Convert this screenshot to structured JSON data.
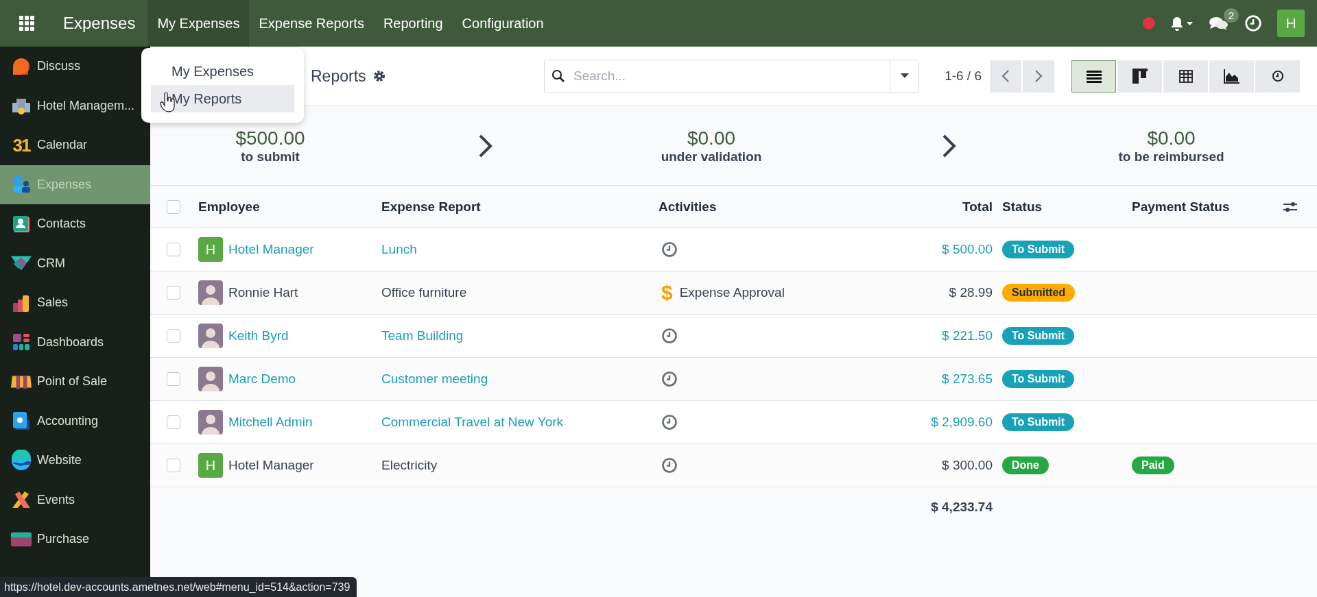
{
  "app_bar": {
    "title": "Expenses",
    "menus": [
      {
        "label": "My Expenses",
        "selected": true
      },
      {
        "label": "Expense Reports",
        "selected": false
      },
      {
        "label": "Reporting",
        "selected": false
      },
      {
        "label": "Configuration",
        "selected": false
      }
    ],
    "messages_badge": "2",
    "user_initial": "H"
  },
  "sidebar": {
    "items": [
      {
        "label": "Discuss",
        "selected": false
      },
      {
        "label": "Hotel Managem...",
        "selected": false
      },
      {
        "label": "Calendar",
        "icon_text": "31",
        "selected": false
      },
      {
        "label": "Expenses",
        "selected": true
      },
      {
        "label": "Contacts",
        "selected": false
      },
      {
        "label": "CRM",
        "selected": false
      },
      {
        "label": "Sales",
        "selected": false
      },
      {
        "label": "Dashboards",
        "selected": false
      },
      {
        "label": "Point of Sale",
        "selected": false
      },
      {
        "label": "Accounting",
        "selected": false
      },
      {
        "label": "Website",
        "selected": false
      },
      {
        "label": "Events",
        "selected": false
      },
      {
        "label": "Purchase",
        "selected": false
      }
    ]
  },
  "dropdown": {
    "items": [
      {
        "label": "My Expenses",
        "selected": false
      },
      {
        "label": "My Reports",
        "selected": true
      }
    ]
  },
  "control_panel": {
    "breadcrumb": "Reports",
    "search": {
      "placeholder": "Search..."
    },
    "pager": "1-6 / 6",
    "views": [
      {
        "kind": "list",
        "selected": true
      },
      {
        "kind": "kanban",
        "selected": false
      },
      {
        "kind": "pivot",
        "selected": false
      },
      {
        "kind": "graph",
        "selected": false
      },
      {
        "kind": "activity",
        "selected": false
      }
    ]
  },
  "summary": [
    {
      "amount": "$500.00",
      "label": "to submit"
    },
    {
      "amount": "$0.00",
      "label": "under validation"
    },
    {
      "amount": "$0.00",
      "label": "to be reimbursed"
    }
  ],
  "table": {
    "all_checked": false,
    "columns": [
      "Employee",
      "Expense Report",
      "Activities",
      "Total",
      "Status",
      "Payment Status"
    ],
    "rows": [
      {
        "checked": false,
        "linked": true,
        "avatar": {
          "kind": "letter",
          "text": "H"
        },
        "employee": "Hotel Manager",
        "report": "Lunch",
        "activity": {
          "kind": "clock"
        },
        "total": "$ 500.00",
        "status": {
          "label": "To Submit",
          "color": "#17a2b8"
        }
      },
      {
        "checked": false,
        "linked": false,
        "avatar": {
          "kind": "photo"
        },
        "employee": "Ronnie Hart",
        "report": "Office furniture",
        "activity": {
          "kind": "todo",
          "icon": "$",
          "label": "Expense Approval"
        },
        "total": "$ 28.99",
        "status": {
          "label": "Submitted",
          "color": "#ffac00"
        }
      },
      {
        "checked": false,
        "linked": true,
        "avatar": {
          "kind": "photo"
        },
        "employee": "Keith Byrd",
        "report": "Team Building",
        "activity": {
          "kind": "clock"
        },
        "total": "$ 221.50",
        "status": {
          "label": "To Submit",
          "color": "#17a2b8"
        }
      },
      {
        "checked": false,
        "linked": true,
        "avatar": {
          "kind": "photo"
        },
        "employee": "Marc Demo",
        "report": "Customer meeting",
        "activity": {
          "kind": "clock"
        },
        "total": "$ 273.65",
        "status": {
          "label": "To Submit",
          "color": "#17a2b8"
        }
      },
      {
        "checked": false,
        "linked": true,
        "avatar": {
          "kind": "photo"
        },
        "employee": "Mitchell Admin",
        "report": "Commercial Travel at New York",
        "activity": {
          "kind": "clock"
        },
        "total": "$ 2,909.60",
        "status": {
          "label": "To Submit",
          "color": "#17a2b8"
        }
      },
      {
        "checked": false,
        "linked": false,
        "avatar": {
          "kind": "letter",
          "text": "H"
        },
        "employee": "Hotel Manager",
        "report": "Electricity",
        "activity": {
          "kind": "clock"
        },
        "total": "$ 300.00",
        "status": {
          "label": "Done",
          "color": "#28a745"
        },
        "payment": {
          "label": "Paid",
          "color": "#28a745"
        }
      }
    ],
    "total": "$ 4,233.74"
  },
  "status_url": "https://hotel.dev-accounts.ametnes.net/web#menu_id=514&action=739"
}
